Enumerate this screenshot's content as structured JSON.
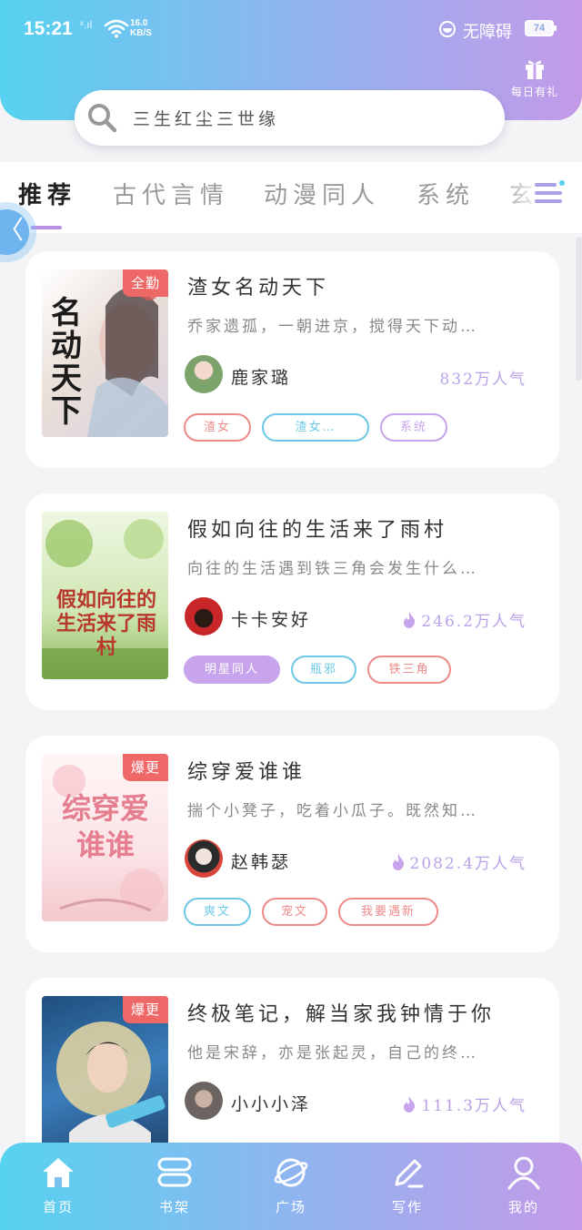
{
  "status": {
    "time": "15:21",
    "signal": "ˣ.ıl",
    "net_speed_value": "16.0",
    "net_speed_unit": "KB/S",
    "accessibility": "无障碍",
    "battery": "74"
  },
  "header": {
    "gift_label": "每日有礼",
    "search_text": "三生红尘三世缘"
  },
  "tabs": [
    "推荐",
    "古代言情",
    "动漫同人",
    "系统",
    "玄"
  ],
  "float_back": "〈",
  "books": [
    {
      "badge": "全勤",
      "cover_text": "名动天下",
      "title": "渣女名动天下",
      "desc": "乔家遗孤，一朝进京，搅得天下动…",
      "author": "鹿家璐",
      "popularity": "832万人气",
      "show_flame": false,
      "tags": [
        {
          "label": "渣女",
          "style": "red"
        },
        {
          "label": "渣女…",
          "style": "cyan"
        },
        {
          "label": "系统",
          "style": "purple"
        }
      ],
      "palette": {
        "bg": "#f4eee9",
        "accent": "#2b2a2a"
      }
    },
    {
      "badge": "",
      "cover_text": "假如向往的生活来了雨村",
      "title": "假如向往的生活来了雨村",
      "desc": "向往的生活遇到铁三角会发生什么…",
      "author": "卡卡安好",
      "popularity": "246.2万人气",
      "show_flame": true,
      "tags": [
        {
          "label": "明星同人",
          "style": "filled"
        },
        {
          "label": "瓶邪",
          "style": "cyan"
        },
        {
          "label": "铁三角",
          "style": "red"
        }
      ],
      "palette": {
        "bg": "#dff0c8",
        "accent": "#b8382b"
      }
    },
    {
      "badge": "爆更",
      "cover_text": "综穿爱谁谁",
      "title": "综穿爱谁谁",
      "desc": "揣个小凳子，吃着小瓜子。既然知…",
      "author": "赵韩瑟",
      "popularity": "2082.4万人气",
      "show_flame": true,
      "tags": [
        {
          "label": "爽文",
          "style": "cyan"
        },
        {
          "label": "宠文",
          "style": "red"
        },
        {
          "label": "我要遇新",
          "style": "red"
        }
      ],
      "palette": {
        "bg": "#fbe9ec",
        "accent": "#e57f90"
      }
    },
    {
      "badge": "爆更",
      "cover_text": "",
      "title": "终极笔记，解当家我钟情于你",
      "desc": "他是宋辞，亦是张起灵，自己的终…",
      "author": "小小小泽",
      "popularity": "111.3万人气",
      "show_flame": true,
      "tags": [],
      "palette": {
        "bg": "#2c5e8e",
        "accent": "#f1d06a"
      }
    }
  ],
  "bottom_nav": [
    {
      "label": "首页",
      "icon": "home-icon"
    },
    {
      "label": "书架",
      "icon": "bookshelf-icon"
    },
    {
      "label": "广场",
      "icon": "planet-icon"
    },
    {
      "label": "写作",
      "icon": "pen-icon"
    },
    {
      "label": "我的",
      "icon": "user-icon"
    }
  ]
}
